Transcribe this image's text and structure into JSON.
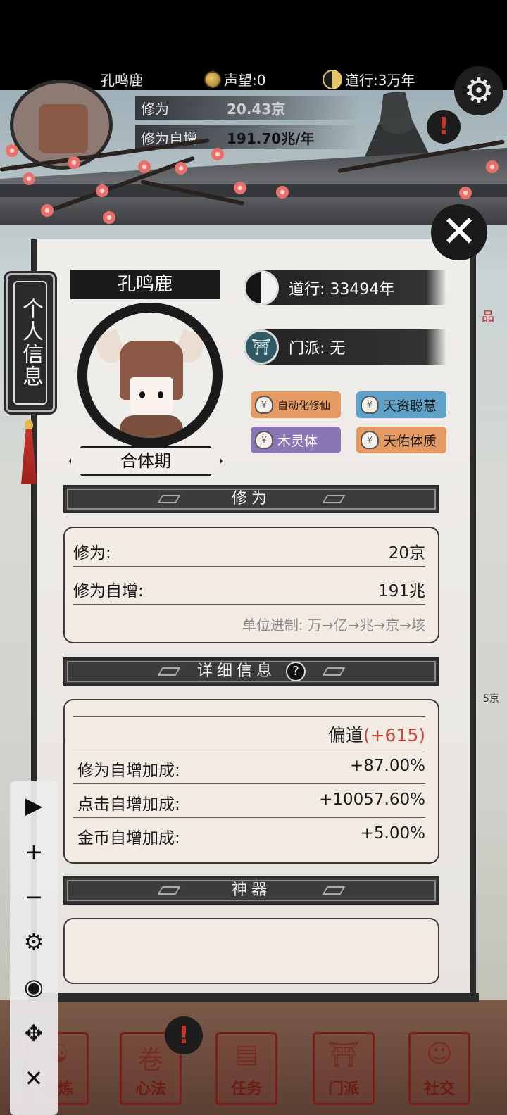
{
  "topbar": {
    "player_name": "孔鸣鹿",
    "reputation": "声望:0",
    "daoxing": "道行:3万年"
  },
  "hud": {
    "cultivation_label": "修为",
    "cultivation_value": "20.43京",
    "auto_label": "修为自增",
    "auto_value": "191.70兆/年"
  },
  "side_tab": {
    "label": "个人信息"
  },
  "profile": {
    "name": "孔鸣鹿",
    "realm": "合体期",
    "daoxing": "道行: 33494年",
    "sect": "门派: 无"
  },
  "traits": [
    {
      "label": "自动化修仙",
      "color": "#e49a62"
    },
    {
      "label": "天资聪慧",
      "color": "#5fa1c8"
    },
    {
      "label": "木灵体",
      "color": "#8a76b5"
    },
    {
      "label": "天佑体质",
      "color": "#e49a62"
    }
  ],
  "cultivation_section": {
    "title": "修为",
    "rows": [
      {
        "label": "修为:",
        "value": "20京"
      },
      {
        "label": "修为自增:",
        "value": "191兆"
      }
    ],
    "unit_note": "单位进制: 万→亿→兆→京→垓"
  },
  "detail_section": {
    "title": "详细信息",
    "path": "偏道",
    "path_bonus": "(+615)",
    "rows": [
      {
        "label": "修为自增加成:",
        "value": "+87.00%"
      },
      {
        "label": "点击自增加成:",
        "value": "+10057.60%"
      },
      {
        "label": "金币自增加成:",
        "value": "+5.00%"
      }
    ]
  },
  "artifact_section": {
    "title": "神器"
  },
  "edge_texts": {
    "right_mid": "5京",
    "right_top": "品"
  },
  "bottom_nav": [
    {
      "label": "修炼"
    },
    {
      "label": "心法"
    },
    {
      "label": "任务"
    },
    {
      "label": "门派"
    },
    {
      "label": "社交"
    }
  ],
  "icons": {
    "play": "play-icon",
    "plus": "plus-icon",
    "minus": "minus-icon",
    "settings": "gear-icon",
    "eye": "eye-icon",
    "move": "move-icon",
    "close": "close-icon"
  }
}
